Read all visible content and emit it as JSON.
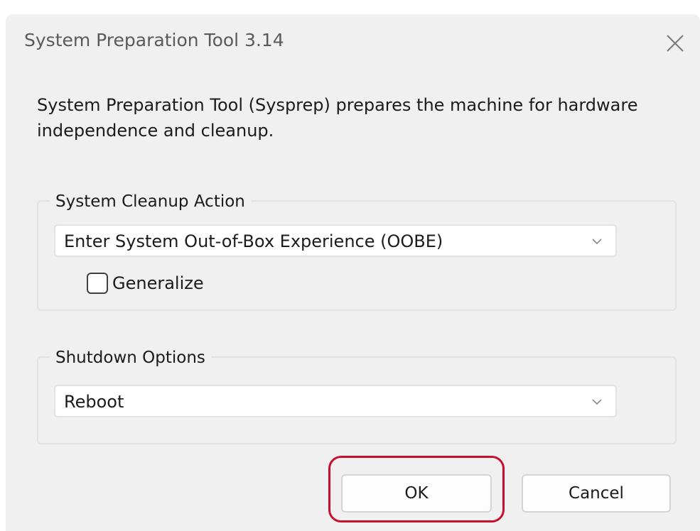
{
  "window": {
    "title": "System Preparation Tool 3.14",
    "close_icon": "close-icon"
  },
  "description": "System Preparation Tool (Sysprep) prepares the machine for hardware independence and cleanup.",
  "cleanup": {
    "legend": "System Cleanup Action",
    "selected": "Enter System Out-of-Box Experience (OOBE)",
    "generalize_label": "Generalize",
    "generalize_checked": false
  },
  "shutdown": {
    "legend": "Shutdown Options",
    "selected": "Reboot"
  },
  "buttons": {
    "ok": "OK",
    "cancel": "Cancel"
  },
  "colors": {
    "dialog_bg": "#f0f0f0",
    "highlight": "#c8102e"
  }
}
